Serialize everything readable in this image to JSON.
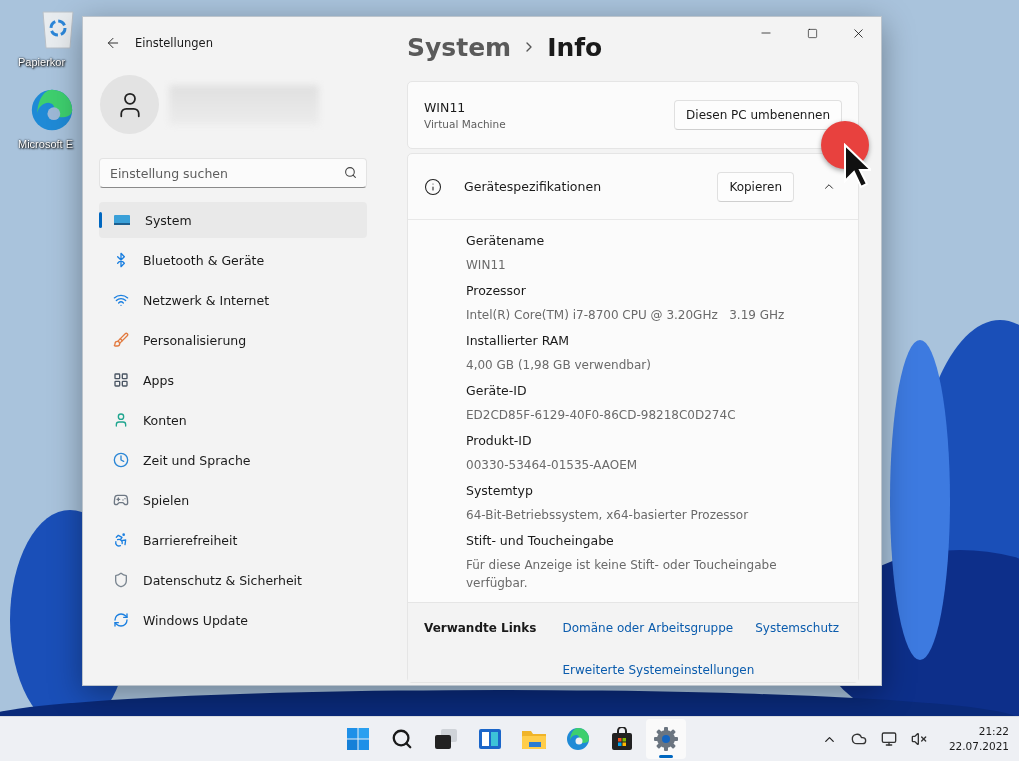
{
  "desktop": {
    "icons": [
      {
        "kind": "bin",
        "label": "Papierkor"
      },
      {
        "kind": "edge",
        "label": "Microsoft E"
      }
    ]
  },
  "window": {
    "title": "Einstellungen"
  },
  "sidebar": {
    "search": {
      "placeholder": "Einstellung suchen"
    },
    "items": [
      {
        "label": "System",
        "selected": true
      },
      {
        "label": "Bluetooth & Geräte",
        "selected": false
      },
      {
        "label": "Netzwerk & Internet",
        "selected": false
      },
      {
        "label": "Personalisierung",
        "selected": false
      },
      {
        "label": "Apps",
        "selected": false
      },
      {
        "label": "Konten",
        "selected": false
      },
      {
        "label": "Zeit und Sprache",
        "selected": false
      },
      {
        "label": "Spielen",
        "selected": false
      },
      {
        "label": "Barrierefreiheit",
        "selected": false
      },
      {
        "label": "Datenschutz & Sicherheit",
        "selected": false
      },
      {
        "label": "Windows Update",
        "selected": false
      }
    ]
  },
  "breadcrumb": {
    "parent": "System",
    "current": "Info"
  },
  "device_card": {
    "name": "WIN11",
    "model": "Virtual Machine",
    "button": "Diesen PC umbenennen"
  },
  "specs": {
    "title": "Gerätespezifikationen",
    "button": "Kopieren",
    "expanded": true,
    "rows": [
      {
        "label": "Gerätename",
        "value": "WIN11"
      },
      {
        "label": "Prozessor",
        "value": "Intel(R) Core(TM) i7-8700 CPU @ 3.20GHz   3.19 GHz"
      },
      {
        "label": "Installierter RAM",
        "value": "4,00 GB (1,98 GB verwendbar)"
      },
      {
        "label": "Geräte-ID",
        "value": "ED2CD85F-6129-40F0-86CD-98218C0D274C"
      },
      {
        "label": "Produkt-ID",
        "value": "00330-53464-01535-AAOEM"
      },
      {
        "label": "Systemtyp",
        "value": "64-Bit-Betriebssystem, x64-basierter Prozessor"
      },
      {
        "label": "Stift- und Toucheingabe",
        "value": "Für diese Anzeige ist keine Stift- oder Toucheingabe verfügbar."
      }
    ]
  },
  "related_links": {
    "title": "Verwandte Links",
    "links": [
      "Domäne oder Arbeitsgruppe",
      "Systemschutz",
      "Erweiterte Systemeinstellungen"
    ]
  },
  "taskbar": {
    "apps": [
      {
        "kind": "start",
        "selected": false
      },
      {
        "kind": "search",
        "selected": false
      },
      {
        "kind": "taskview",
        "selected": false
      },
      {
        "kind": "widgets",
        "selected": false
      },
      {
        "kind": "explorer",
        "selected": false
      },
      {
        "kind": "edge",
        "selected": false
      },
      {
        "kind": "store",
        "selected": false
      },
      {
        "kind": "settings",
        "selected": true
      }
    ],
    "clock": {
      "time": "21:22",
      "date": "22.07.2021"
    }
  }
}
